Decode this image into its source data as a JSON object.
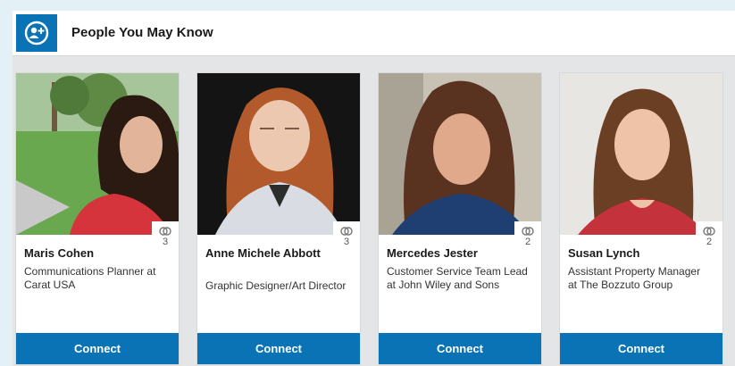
{
  "header": {
    "title": "People You May Know",
    "icon": "add-connection-icon"
  },
  "colors": {
    "accent": "#0a73b5"
  },
  "people": [
    {
      "name": "Maris Cohen",
      "title": "Communications Planner at Carat USA",
      "shared_connections": "3",
      "connect_label": "Connect"
    },
    {
      "name": "Anne Michele Abbott",
      "title": "Graphic Designer/Art Director",
      "shared_connections": "3",
      "connect_label": "Connect"
    },
    {
      "name": "Mercedes Jester",
      "title": "Customer Service Team Lead at John Wiley and Sons",
      "shared_connections": "2",
      "connect_label": "Connect"
    },
    {
      "name": "Susan Lynch",
      "title": "Assistant Property Manager at The Bozzuto Group",
      "shared_connections": "2",
      "connect_label": "Connect"
    }
  ]
}
